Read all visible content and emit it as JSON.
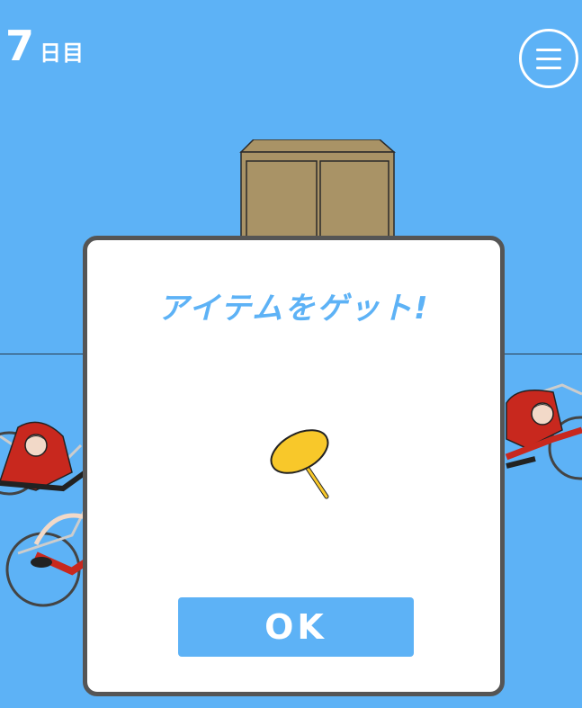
{
  "header": {
    "day_number": "7",
    "day_unit": "日目"
  },
  "dialog": {
    "title": "アイテムをゲット!",
    "ok_label": "OK"
  },
  "item": {
    "icon": "thumbtack-icon",
    "head_color": "#f8c82a"
  },
  "colors": {
    "background": "#5db2f6",
    "accent": "#5db2f6",
    "dialog_border": "#555555",
    "cabinet": "#a99366",
    "jersey": "#c8281e"
  }
}
